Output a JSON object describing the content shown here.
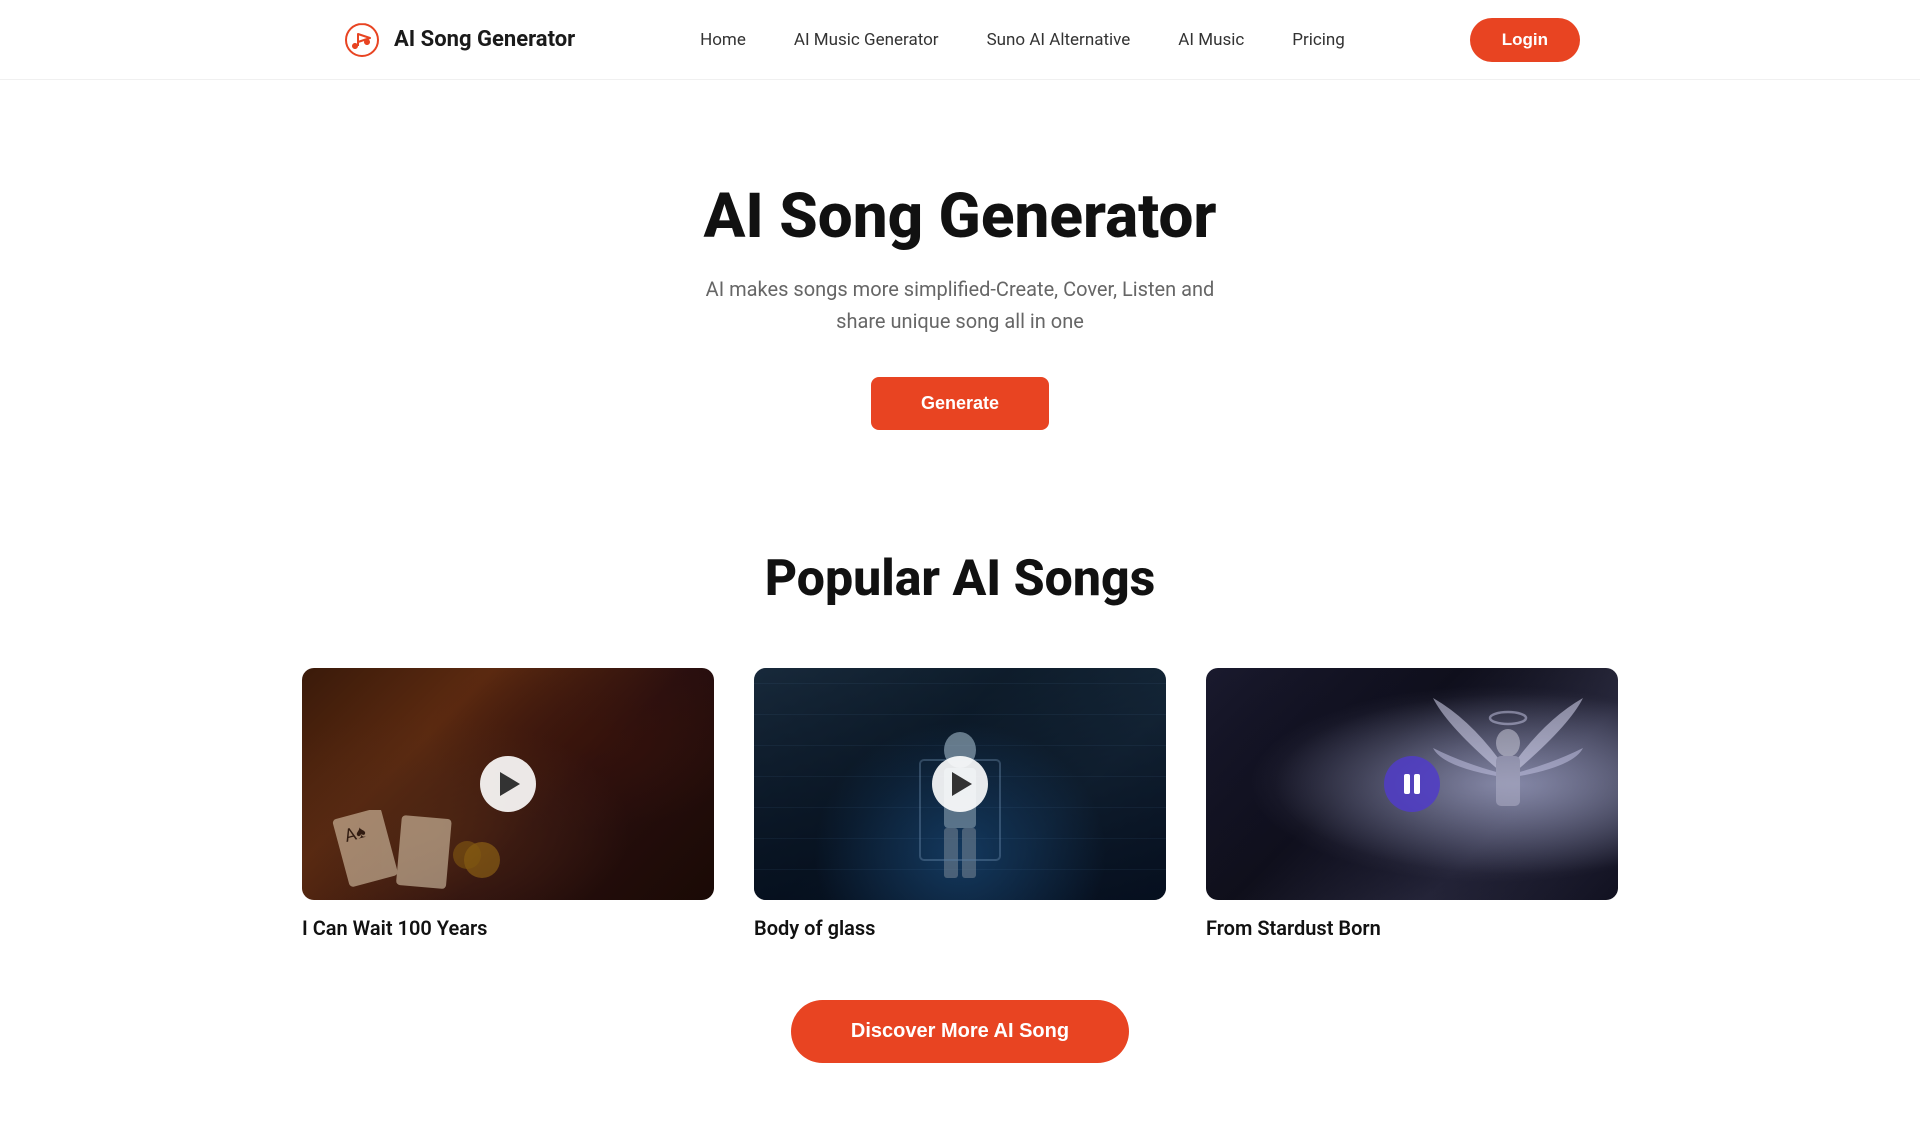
{
  "brand": {
    "name": "AI Song Generator",
    "logo_alt": "music-note-heart-icon"
  },
  "nav": {
    "links": [
      {
        "label": "Home",
        "id": "home"
      },
      {
        "label": "AI Music Generator",
        "id": "ai-music-generator"
      },
      {
        "label": "Suno AI Alternative",
        "id": "suno-ai-alternative"
      },
      {
        "label": "AI Music",
        "id": "ai-music"
      },
      {
        "label": "Pricing",
        "id": "pricing"
      }
    ],
    "login_label": "Login"
  },
  "hero": {
    "title": "AI Song Generator",
    "subtitle": "AI makes songs more simplified-Create, Cover, Listen and share unique song all in one",
    "generate_label": "Generate"
  },
  "popular": {
    "section_title": "Popular AI Songs",
    "songs": [
      {
        "id": "song-1",
        "name": "I Can Wait 100 Years",
        "playing": false,
        "card_theme": "poker"
      },
      {
        "id": "song-2",
        "name": "Body of glass",
        "playing": false,
        "card_theme": "corridor"
      },
      {
        "id": "song-3",
        "name": "From Stardust Born",
        "playing": true,
        "card_theme": "angel"
      }
    ],
    "discover_label": "Discover More AI Song"
  }
}
